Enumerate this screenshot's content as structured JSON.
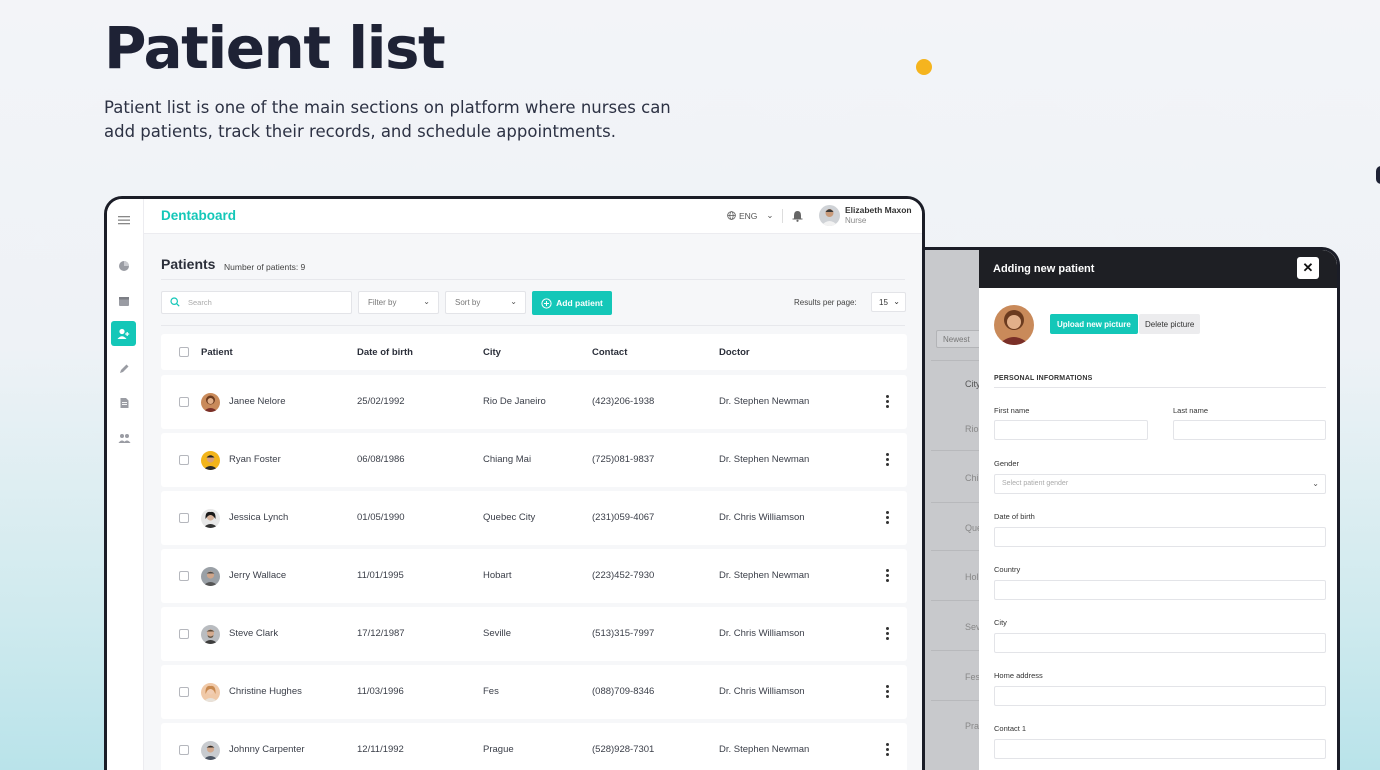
{
  "hero": {
    "title": "Patient list",
    "description": "Patient list is one of the main sections on platform where nurses can add patients, track their records, and schedule appointments."
  },
  "colors": {
    "accent": "#14c7b8",
    "dot": "#f5b41e",
    "dark": "#1e2235"
  },
  "app": {
    "brand": "Dentaboard",
    "language": "ENG",
    "user": {
      "name": "Elizabeth Maxon",
      "role": "Nurse"
    },
    "sidebar_icons": [
      "dashboard-icon",
      "calendar-icon",
      "patients-icon",
      "edit-icon",
      "document-icon",
      "team-icon"
    ]
  },
  "patients": {
    "title": "Patients",
    "count_label": "Number of patients: 9",
    "search_placeholder": "Search",
    "filter_label": "Filter by",
    "sort_label": "Sort by",
    "add_label": "Add patient",
    "results_label": "Results per page:",
    "results_value": "15",
    "columns": [
      "Patient",
      "Date of birth",
      "City",
      "Contact",
      "Doctor"
    ],
    "rows": [
      {
        "name": "Janee Nelore",
        "dob": "25/02/1992",
        "city": "Rio De Janeiro",
        "contact": "(423)206-1938",
        "doctor": "Dr. Stephen Newman"
      },
      {
        "name": "Ryan Foster",
        "dob": "06/08/1986",
        "city": "Chiang Mai",
        "contact": "(725)081-9837",
        "doctor": "Dr. Stephen Newman"
      },
      {
        "name": "Jessica Lynch",
        "dob": "01/05/1990",
        "city": "Quebec City",
        "contact": "(231)059-4067",
        "doctor": "Dr. Chris Williamson"
      },
      {
        "name": "Jerry Wallace",
        "dob": "11/01/1995",
        "city": "Hobart",
        "contact": "(223)452-7930",
        "doctor": "Dr. Stephen Newman"
      },
      {
        "name": "Steve Clark",
        "dob": "17/12/1987",
        "city": "Seville",
        "contact": "(513)315-7997",
        "doctor": "Dr. Chris Williamson"
      },
      {
        "name": "Christine Hughes",
        "dob": "11/03/1996",
        "city": "Fes",
        "contact": "(088)709-8346",
        "doctor": "Dr. Chris Williamson"
      },
      {
        "name": "Johnny Carpenter",
        "dob": "12/11/1992",
        "city": "Prague",
        "contact": "(528)928-7301",
        "doctor": "Dr. Stephen Newman"
      }
    ]
  },
  "background_list": {
    "sort_chip": "Newest",
    "header_fragment": "City",
    "city_fragments": [
      "Rio",
      "Chi",
      "Que",
      "Hol",
      "Sev",
      "Fes",
      "Pra"
    ]
  },
  "modal": {
    "title": "Adding new patient",
    "close_glyph": "✕",
    "upload_label": "Upload new picture",
    "delete_label": "Delete picture",
    "section_label": "PERSONAL INFORMATIONS",
    "first_name_label": "First name",
    "last_name_label": "Last name",
    "gender_label": "Gender",
    "gender_placeholder": "Select patient gender",
    "dob_label": "Date of birth",
    "country_label": "Country",
    "city_label": "City",
    "address_label": "Home address",
    "contact_label": "Contact 1"
  }
}
